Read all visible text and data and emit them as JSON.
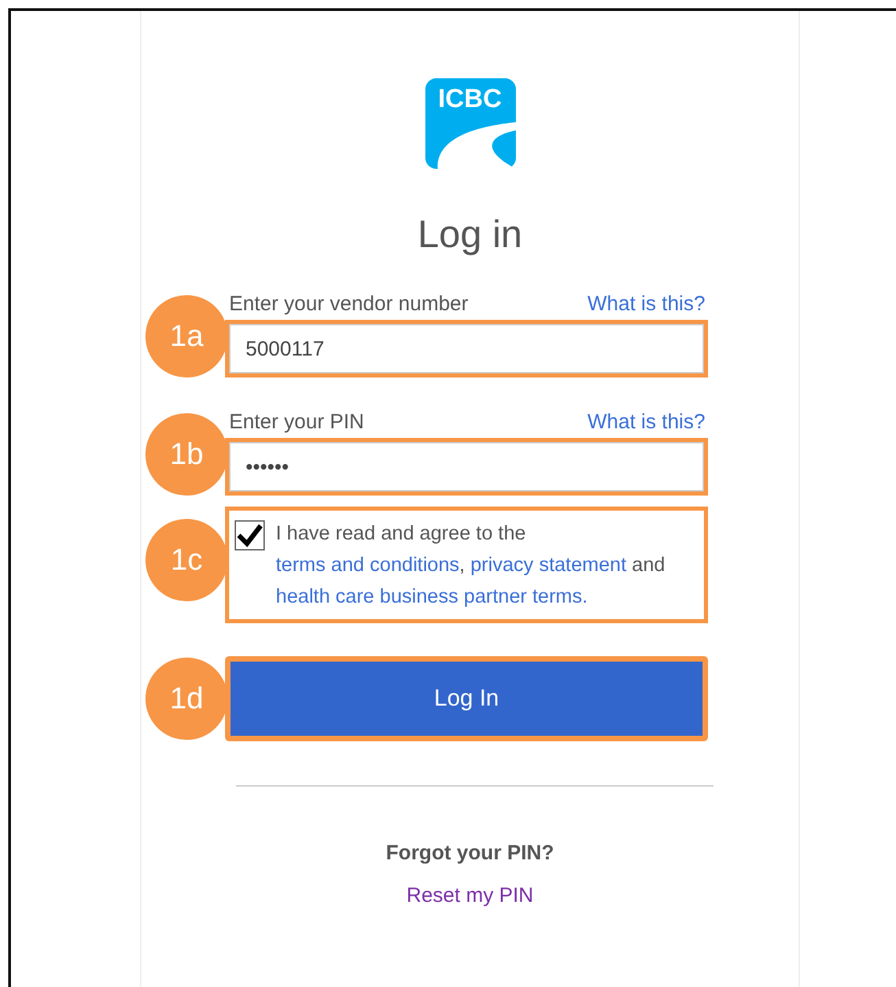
{
  "logo": {
    "text": "ICBC"
  },
  "title": "Log in",
  "fields": [
    {
      "label": "Enter your vendor number",
      "help_link": "What is this?",
      "value": "5000117",
      "callout": "1a"
    },
    {
      "label": "Enter your PIN",
      "help_link": "What is this?",
      "value": "••••••",
      "callout": "1b"
    }
  ],
  "consent": {
    "checked": true,
    "callout": "1c",
    "parts": [
      {
        "kind": "plain",
        "text": "I have read and agree to the "
      },
      {
        "kind": "link",
        "text": "terms and conditions"
      },
      {
        "kind": "plain",
        "text": ", "
      },
      {
        "kind": "link",
        "text": "privacy statement"
      },
      {
        "kind": "plain",
        "text": " and "
      },
      {
        "kind": "link",
        "text": "health care business partner terms."
      }
    ]
  },
  "submit": {
    "label": "Log In",
    "callout": "1d"
  },
  "forgot": {
    "text": "Forgot your PIN?",
    "link": "Reset my PIN"
  }
}
